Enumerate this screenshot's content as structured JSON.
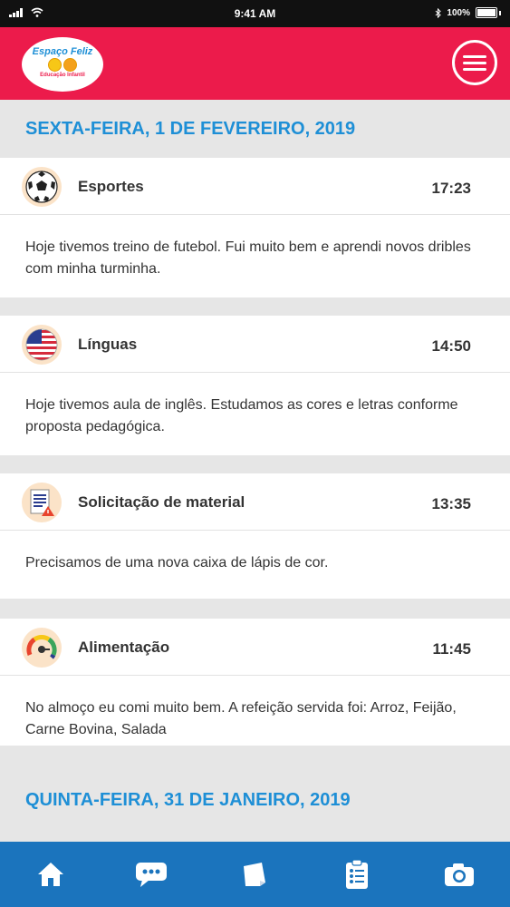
{
  "status_bar": {
    "time": "9:41 AM",
    "battery": "100%"
  },
  "header": {
    "logo_brand": "Espaço Feliz",
    "logo_sub": "Educação Infantil"
  },
  "sections": [
    {
      "date": "SEXTA-FEIRA, 1 DE FEVEREIRO, 2019",
      "items": [
        {
          "icon": "soccer-ball-icon",
          "title": "Esportes",
          "time": "17:23",
          "text": "Hoje tivemos treino de futebol. Fui muito bem e aprendi novos dribles com minha turminha."
        },
        {
          "icon": "us-flag-icon",
          "title": "Línguas",
          "time": "14:50",
          "text": "Hoje tivemos aula de inglês. Estudamos as cores e letras conforme proposta pedagógica."
        },
        {
          "icon": "material-request-icon",
          "title": "Solicitação de material",
          "time": "13:35",
          "text": "Precisamos de uma nova caixa de lápis de cor."
        },
        {
          "icon": "meal-gauge-icon",
          "title": "Alimentação",
          "time": "11:45",
          "text": "No almoço eu comi muito bem. A refeição servida foi: Arroz, Feijão, Carne Bovina, Salada"
        }
      ]
    },
    {
      "date": "QUINTA-FEIRA, 31 DE JANEIRO, 2019",
      "items": []
    }
  ],
  "bottom_nav": [
    "home-icon",
    "chat-icon",
    "notes-icon",
    "checklist-icon",
    "camera-icon"
  ],
  "colors": {
    "header": "#ec1b4b",
    "accent": "#1e8fd6",
    "nav": "#1b74bd"
  }
}
